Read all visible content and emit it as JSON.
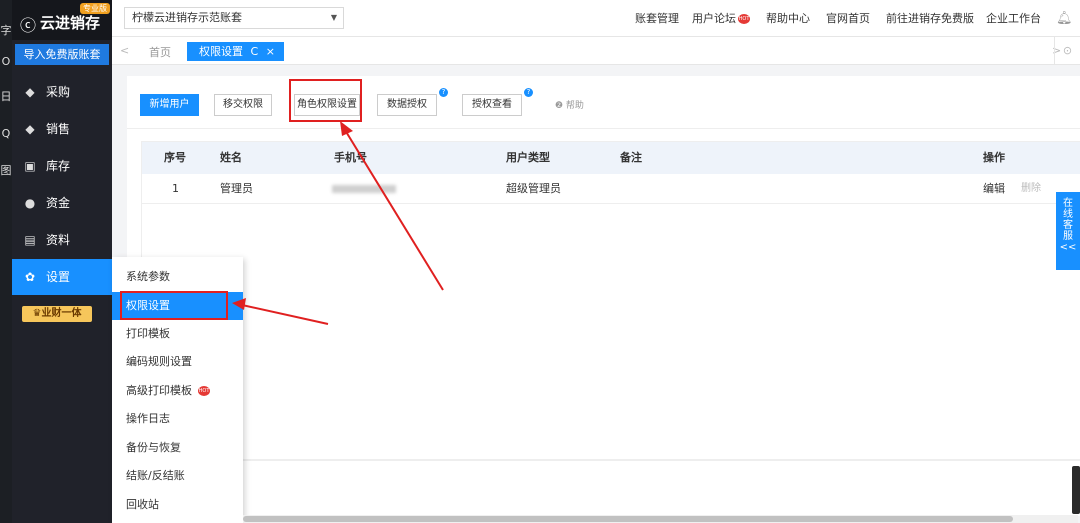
{
  "left_edge": {
    "glyphs": [
      "字",
      "O",
      "日",
      "Q",
      "图"
    ]
  },
  "sidebar": {
    "logo_mark": "ⓒ",
    "logo_name": "云进销存",
    "logo_badge": "专业版",
    "import_button": "导入免费版账套",
    "items": [
      {
        "label": "采购",
        "icon": "bag-icon",
        "glyph": "◆"
      },
      {
        "label": "销售",
        "icon": "tag-icon",
        "glyph": "◆"
      },
      {
        "label": "库存",
        "icon": "warehouse-icon",
        "glyph": "▣"
      },
      {
        "label": "资金",
        "icon": "money-icon",
        "glyph": "●"
      },
      {
        "label": "资料",
        "icon": "document-icon",
        "glyph": "▤"
      },
      {
        "label": "设置",
        "icon": "gear-icon",
        "glyph": "✿"
      }
    ],
    "vip_badge": "♛业财一体"
  },
  "topbar": {
    "account_select": "柠檬云进销存示范账套",
    "links": [
      "账套管理",
      "用户论坛",
      "帮助中心",
      "官网首页",
      "前往进销存免费版",
      "企业工作台"
    ],
    "hot_label": "HOT"
  },
  "tabs": {
    "prev_arrow": "<",
    "home": "首页",
    "active": "权限设置",
    "refresh_glyph": "C",
    "close_glyph": "×",
    "next_arrow": ">",
    "right_glyph": "⊙"
  },
  "toolbar": {
    "buttons": [
      "新增用户",
      "移交权限",
      "角色权限设置",
      "数据授权",
      "授权查看"
    ],
    "question_glyph": "?",
    "help": "❷ 帮助"
  },
  "table": {
    "headers": [
      "序号",
      "姓名",
      "手机号",
      "用户类型",
      "备注",
      "操作"
    ],
    "rows": [
      {
        "index": "1",
        "name": "管理员",
        "phone": "",
        "type": "超级管理员",
        "note": "",
        "edit": "编辑",
        "delete": "删除"
      }
    ]
  },
  "settings_menu": {
    "items": [
      "系统参数",
      "权限设置",
      "打印模板",
      "编码规则设置",
      "高级打印模板",
      "操作日志",
      "备份与恢复",
      "结账/反结账",
      "回收站"
    ],
    "hot_label": "HOT"
  },
  "online_service": [
    "在",
    "线",
    "客",
    "服",
    "<<"
  ]
}
